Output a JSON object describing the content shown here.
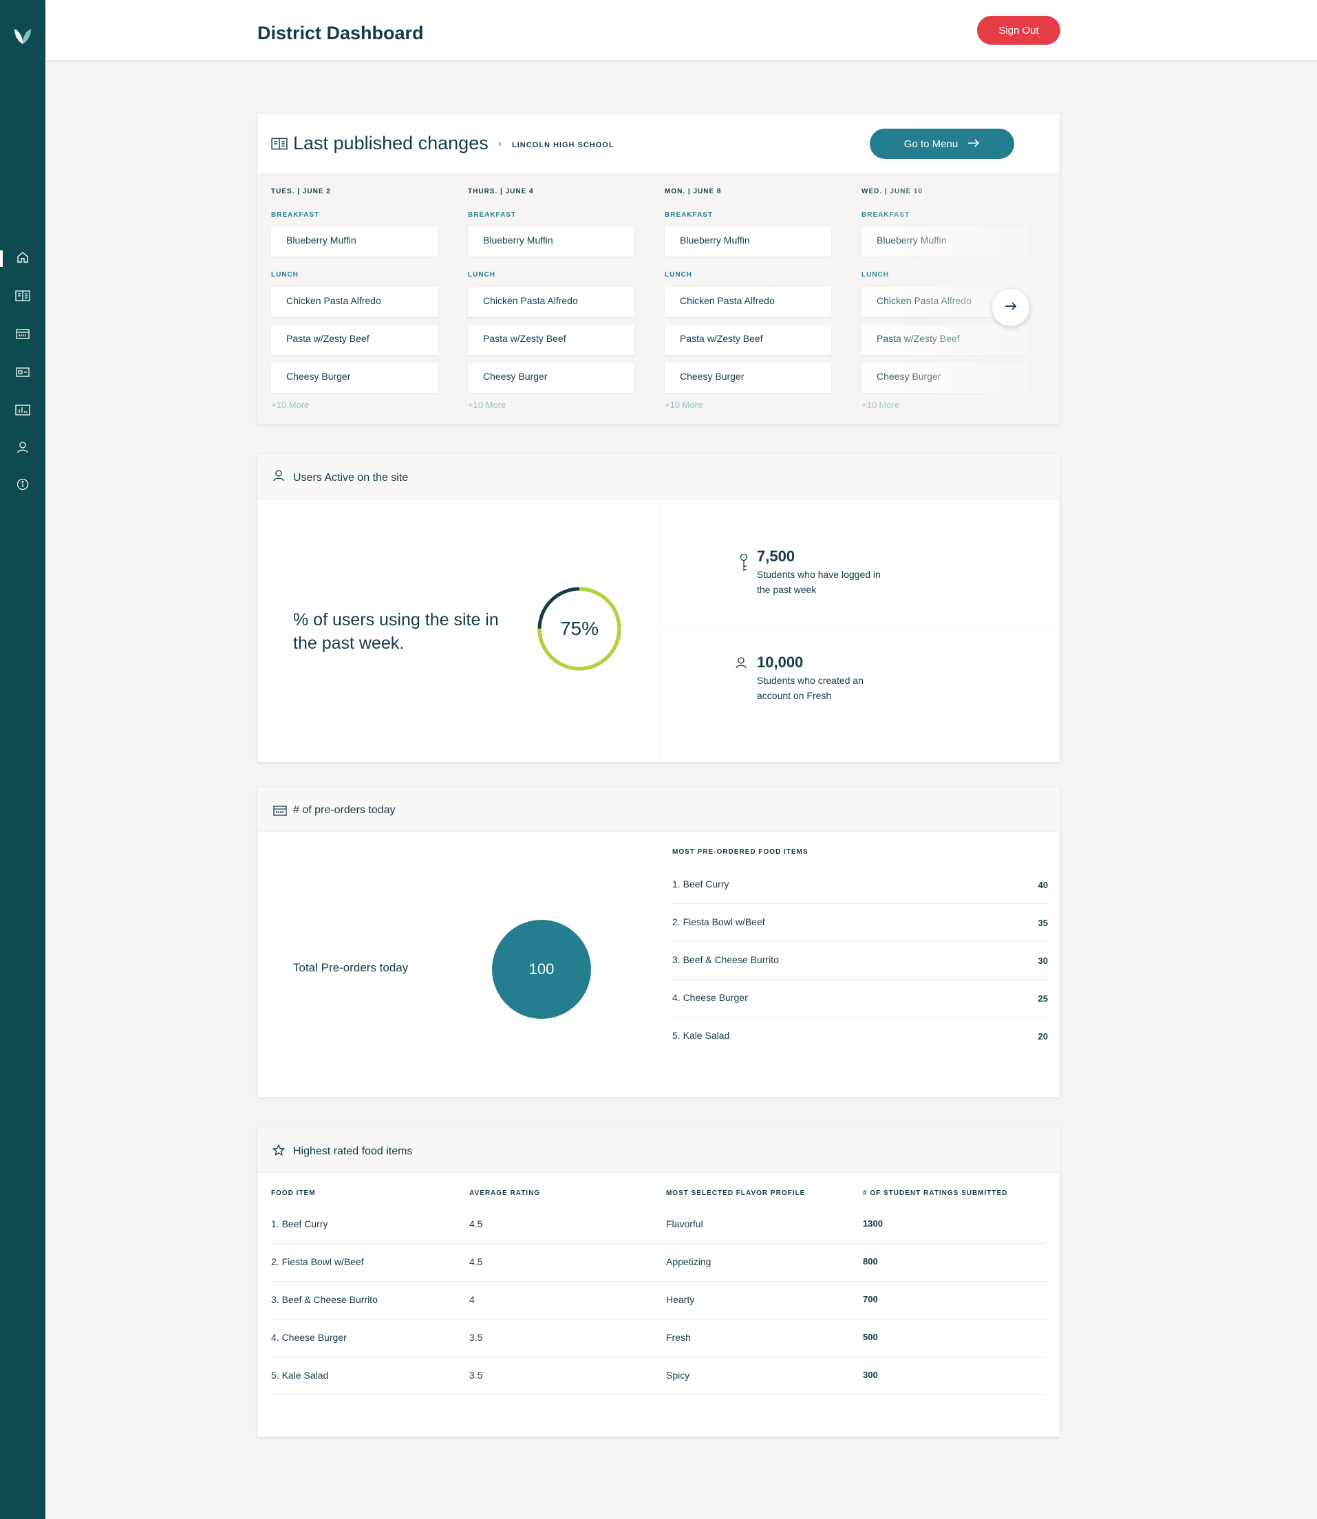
{
  "header": {
    "title": "District Dashboard",
    "sign_out_label": "Sign Out"
  },
  "sidebar": {
    "items": [
      {
        "icon": "home-icon"
      },
      {
        "icon": "menu-book-icon"
      },
      {
        "icon": "calendar-icon"
      },
      {
        "icon": "card-icon"
      },
      {
        "icon": "bar-chart-icon"
      },
      {
        "icon": "user-icon"
      },
      {
        "icon": "info-icon"
      }
    ]
  },
  "publish": {
    "title": "Last published changes",
    "school": "LINCOLN HIGH SCHOOL",
    "go_menu_label": "Go to Menu",
    "days": [
      {
        "label": "TUES.  |  JUNE 2",
        "breakfast_label": "BREAKFAST",
        "breakfast": [
          "Blueberry Muffin"
        ],
        "lunch_label": "LUNCH",
        "lunch": [
          "Chicken Pasta Alfredo",
          "Pasta w/Zesty Beef",
          "Cheesy Burger"
        ],
        "more": "+10 More"
      },
      {
        "label": "THURS.  |  JUNE 4",
        "breakfast_label": "BREAKFAST",
        "breakfast": [
          "Blueberry Muffin"
        ],
        "lunch_label": "LUNCH",
        "lunch": [
          "Chicken Pasta Alfredo",
          "Pasta w/Zesty Beef",
          "Cheesy Burger"
        ],
        "more": "+10 More"
      },
      {
        "label": "MON.  |  JUNE 8",
        "breakfast_label": "BREAKFAST",
        "breakfast": [
          "Blueberry Muffin"
        ],
        "lunch_label": "LUNCH",
        "lunch": [
          "Chicken Pasta Alfredo",
          "Pasta w/Zesty Beef",
          "Cheesy Burger"
        ],
        "more": "+10 More"
      },
      {
        "label": "WED.  |  JUNE 10",
        "breakfast_label": "BREAKFAST",
        "breakfast": [
          "Blueberry Muffin"
        ],
        "lunch_label": "LUNCH",
        "lunch": [
          "Chicken Pasta Alfredo",
          "Pasta w/Zesty Beef",
          "Cheesy Burger"
        ],
        "more": "+10 More"
      }
    ]
  },
  "users": {
    "title": "Users Active on the site",
    "percent_text": "% of users using the site in the past week.",
    "percent_value": 75,
    "percent_label": "75%",
    "stats": [
      {
        "icon": "key-icon",
        "value": "7,500",
        "desc": "Students who have logged in the past week"
      },
      {
        "icon": "user-icon",
        "value": "10,000",
        "desc": "Students who created an account on Fresh"
      }
    ]
  },
  "preorders": {
    "title": "# of pre-orders today",
    "total_label": "Total Pre-orders today",
    "total_value": "100",
    "list_title": "MOST PRE-ORDERED FOOD ITEMS",
    "items": [
      {
        "name": "1. Beef Curry",
        "value": "40"
      },
      {
        "name": "2. Fiesta Bowl w/Beef",
        "value": "35"
      },
      {
        "name": "3. Beef & Cheese Burrito",
        "value": "30"
      },
      {
        "name": "4. Cheese Burger",
        "value": "25"
      },
      {
        "name": "5. Kale Salad",
        "value": "20"
      }
    ]
  },
  "rated": {
    "title": "Highest rated food items",
    "columns": [
      "FOOD ITEM",
      "AVERAGE RATING",
      "MOST SELECTED FLAVOR PROFILE",
      "# OF STUDENT RATINGS SUBMITTED"
    ],
    "rows": [
      [
        "1. Beef Curry",
        "4.5",
        "Flavorful",
        "1300"
      ],
      [
        "2. Fiesta Bowl w/Beef",
        "4.5",
        "Appetizing",
        "800"
      ],
      [
        "3. Beef & Cheese Burrito",
        "4",
        "Hearty",
        "700"
      ],
      [
        "4. Cheese Burger",
        "3.5",
        "Fresh",
        "500"
      ],
      [
        "5. Kale Salad",
        "3.5",
        "Spicy",
        "300"
      ]
    ]
  },
  "colors": {
    "sidebar": "#0e4b51",
    "primary": "#257e90",
    "danger": "#e63c46",
    "ring_progress": "#b5d334",
    "ring_track": "#173b47"
  }
}
